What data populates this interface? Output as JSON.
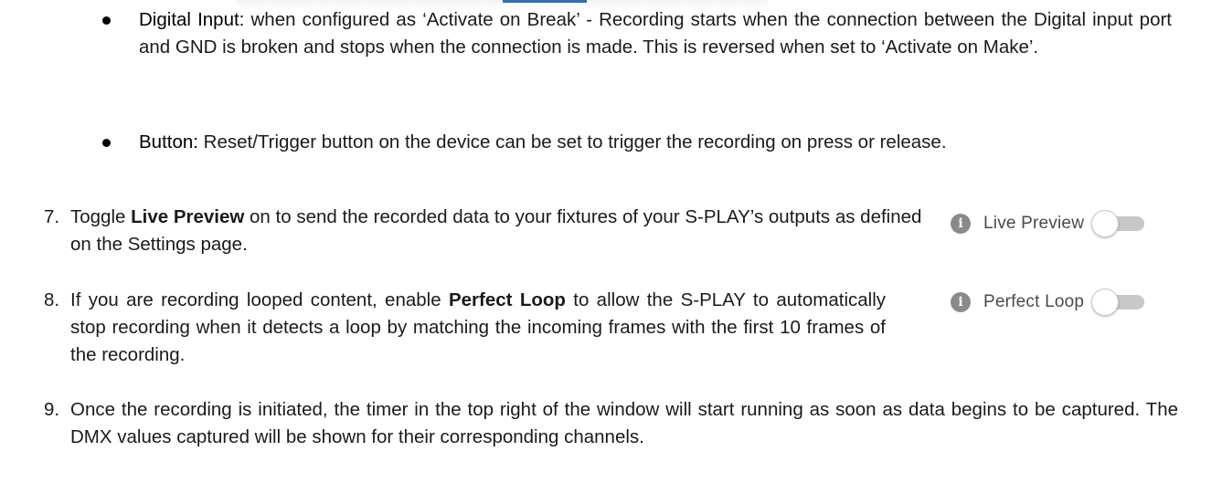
{
  "bullets": [
    {
      "term": "Digital Input:",
      "text": " when configured as ‘Activate on Break’ - Recording starts when the connection between the Digital input port and GND is broken and stops when the connection is made. This is reversed when set to ‘Activate on Make’."
    },
    {
      "term": "Button:",
      "text": " Reset/Trigger button on the device can be set to trigger the recording on press or release."
    }
  ],
  "steps": [
    {
      "number": "7.",
      "before": "Toggle ",
      "bold": "Live Preview",
      "after": " on to send the recorded data to your fixtures of your S-PLAY’s outputs as defined on the Settings page."
    },
    {
      "number": "8.",
      "before": "If you are recording looped content, enable ",
      "bold": "Perfect Loop",
      "after": " to allow the S-PLAY to automatically stop recording when it detects a loop by matching the incoming frames with the first 10 frames of the recording."
    },
    {
      "number": "9.",
      "text": "Once the recording is initiated, the timer in the top right of the window will start running as soon as data begins to be captured. The DMX values captured will be shown for their corresponding channels."
    }
  ],
  "toggles": [
    {
      "icon": "info-icon",
      "label": "Live Preview",
      "state": "off"
    },
    {
      "icon": "info-icon",
      "label": "Perfect Loop",
      "state": "off"
    }
  ],
  "colors": {
    "accent": "#2f6db5",
    "icon": "#8a8a8a",
    "track": "#c8c8c8"
  }
}
